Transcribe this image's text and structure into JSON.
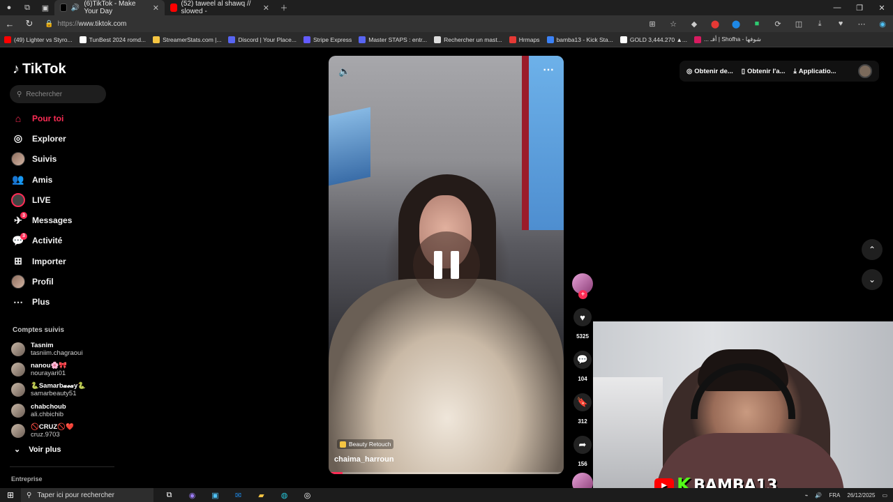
{
  "browser": {
    "tabs": [
      {
        "title": "(6)TikTok - Make Your Day",
        "active": true,
        "color": "#000000"
      },
      {
        "title": "(52) taweel al shawq // slowed -",
        "active": false,
        "color": "#ff0000"
      }
    ],
    "url_protocol": "https://",
    "url_host": "www.tiktok.com",
    "bookmarks": [
      {
        "label": "(49) Lighter vs Styro...",
        "color": "#ff0000"
      },
      {
        "label": "TunBest 2024 romd...",
        "color": "#ffffff"
      },
      {
        "label": "StreamerStats.com |...",
        "color": "#f5c542"
      },
      {
        "label": "Discord | Your Place...",
        "color": "#5865f2"
      },
      {
        "label": "Stripe Express",
        "color": "#635bff"
      },
      {
        "label": "Master STAPS : entr...",
        "color": "#5865f2"
      },
      {
        "label": "Rechercher un mast...",
        "color": "#dddddd"
      },
      {
        "label": "Hrmaps",
        "color": "#e53935"
      },
      {
        "label": "bamba13 - Kick Sta...",
        "color": "#3b82f6"
      },
      {
        "label": "GOLD 3,444.270 ▲...",
        "color": "#ffffff"
      },
      {
        "label": "... أفـ | Shofha - شوفها",
        "color": "#d81b60"
      }
    ]
  },
  "tiktok": {
    "logo": "TikTok",
    "search_placeholder": "Rechercher",
    "nav": [
      {
        "label": "Pour toi",
        "icon": "home-icon",
        "active": true
      },
      {
        "label": "Explorer",
        "icon": "compass-icon"
      },
      {
        "label": "Suivis",
        "icon": "following-avatar-icon"
      },
      {
        "label": "Amis",
        "icon": "friends-icon"
      },
      {
        "label": "LIVE",
        "icon": "live-icon"
      },
      {
        "label": "Messages",
        "icon": "messages-icon",
        "badge": "3"
      },
      {
        "label": "Activité",
        "icon": "activity-icon",
        "badge": "3"
      },
      {
        "label": "Importer",
        "icon": "upload-icon"
      },
      {
        "label": "Profil",
        "icon": "profile-avatar-icon"
      },
      {
        "label": "Plus",
        "icon": "more-icon"
      }
    ],
    "following_title": "Comptes suivis",
    "following": [
      {
        "name": "Tasnim",
        "handle": "tasniim.chagraoui"
      },
      {
        "name": "nanou🌸🎀",
        "handle": "nourayari01"
      },
      {
        "name": "🐍Samarb𝓪𝓮𝓪y🐍",
        "handle": "samarbeauty51"
      },
      {
        "name": "chabchoub",
        "handle": "ali.chbichib"
      },
      {
        "name": "🚫CRUZ🚫❤️",
        "handle": "cruz.9703"
      }
    ],
    "voir_plus": "Voir plus",
    "entreprise": "Entreprise",
    "video": {
      "effect": "Beauty Retouch",
      "author": "chaima_harroun",
      "progress": 0.06
    },
    "actions": {
      "likes": "5325",
      "comments": "104",
      "saves": "312",
      "shares": "156"
    },
    "top_right": {
      "coins": "Obtenir de...",
      "app": "Obtenir l'a...",
      "desktop_app": "Applicatio..."
    }
  },
  "webcam": {
    "brand": "BAMBA13",
    "k_logo": "K"
  },
  "taskbar": {
    "search_placeholder": "Taper ici pour rechercher",
    "lang": "FRA",
    "date": "26/12/2025"
  }
}
